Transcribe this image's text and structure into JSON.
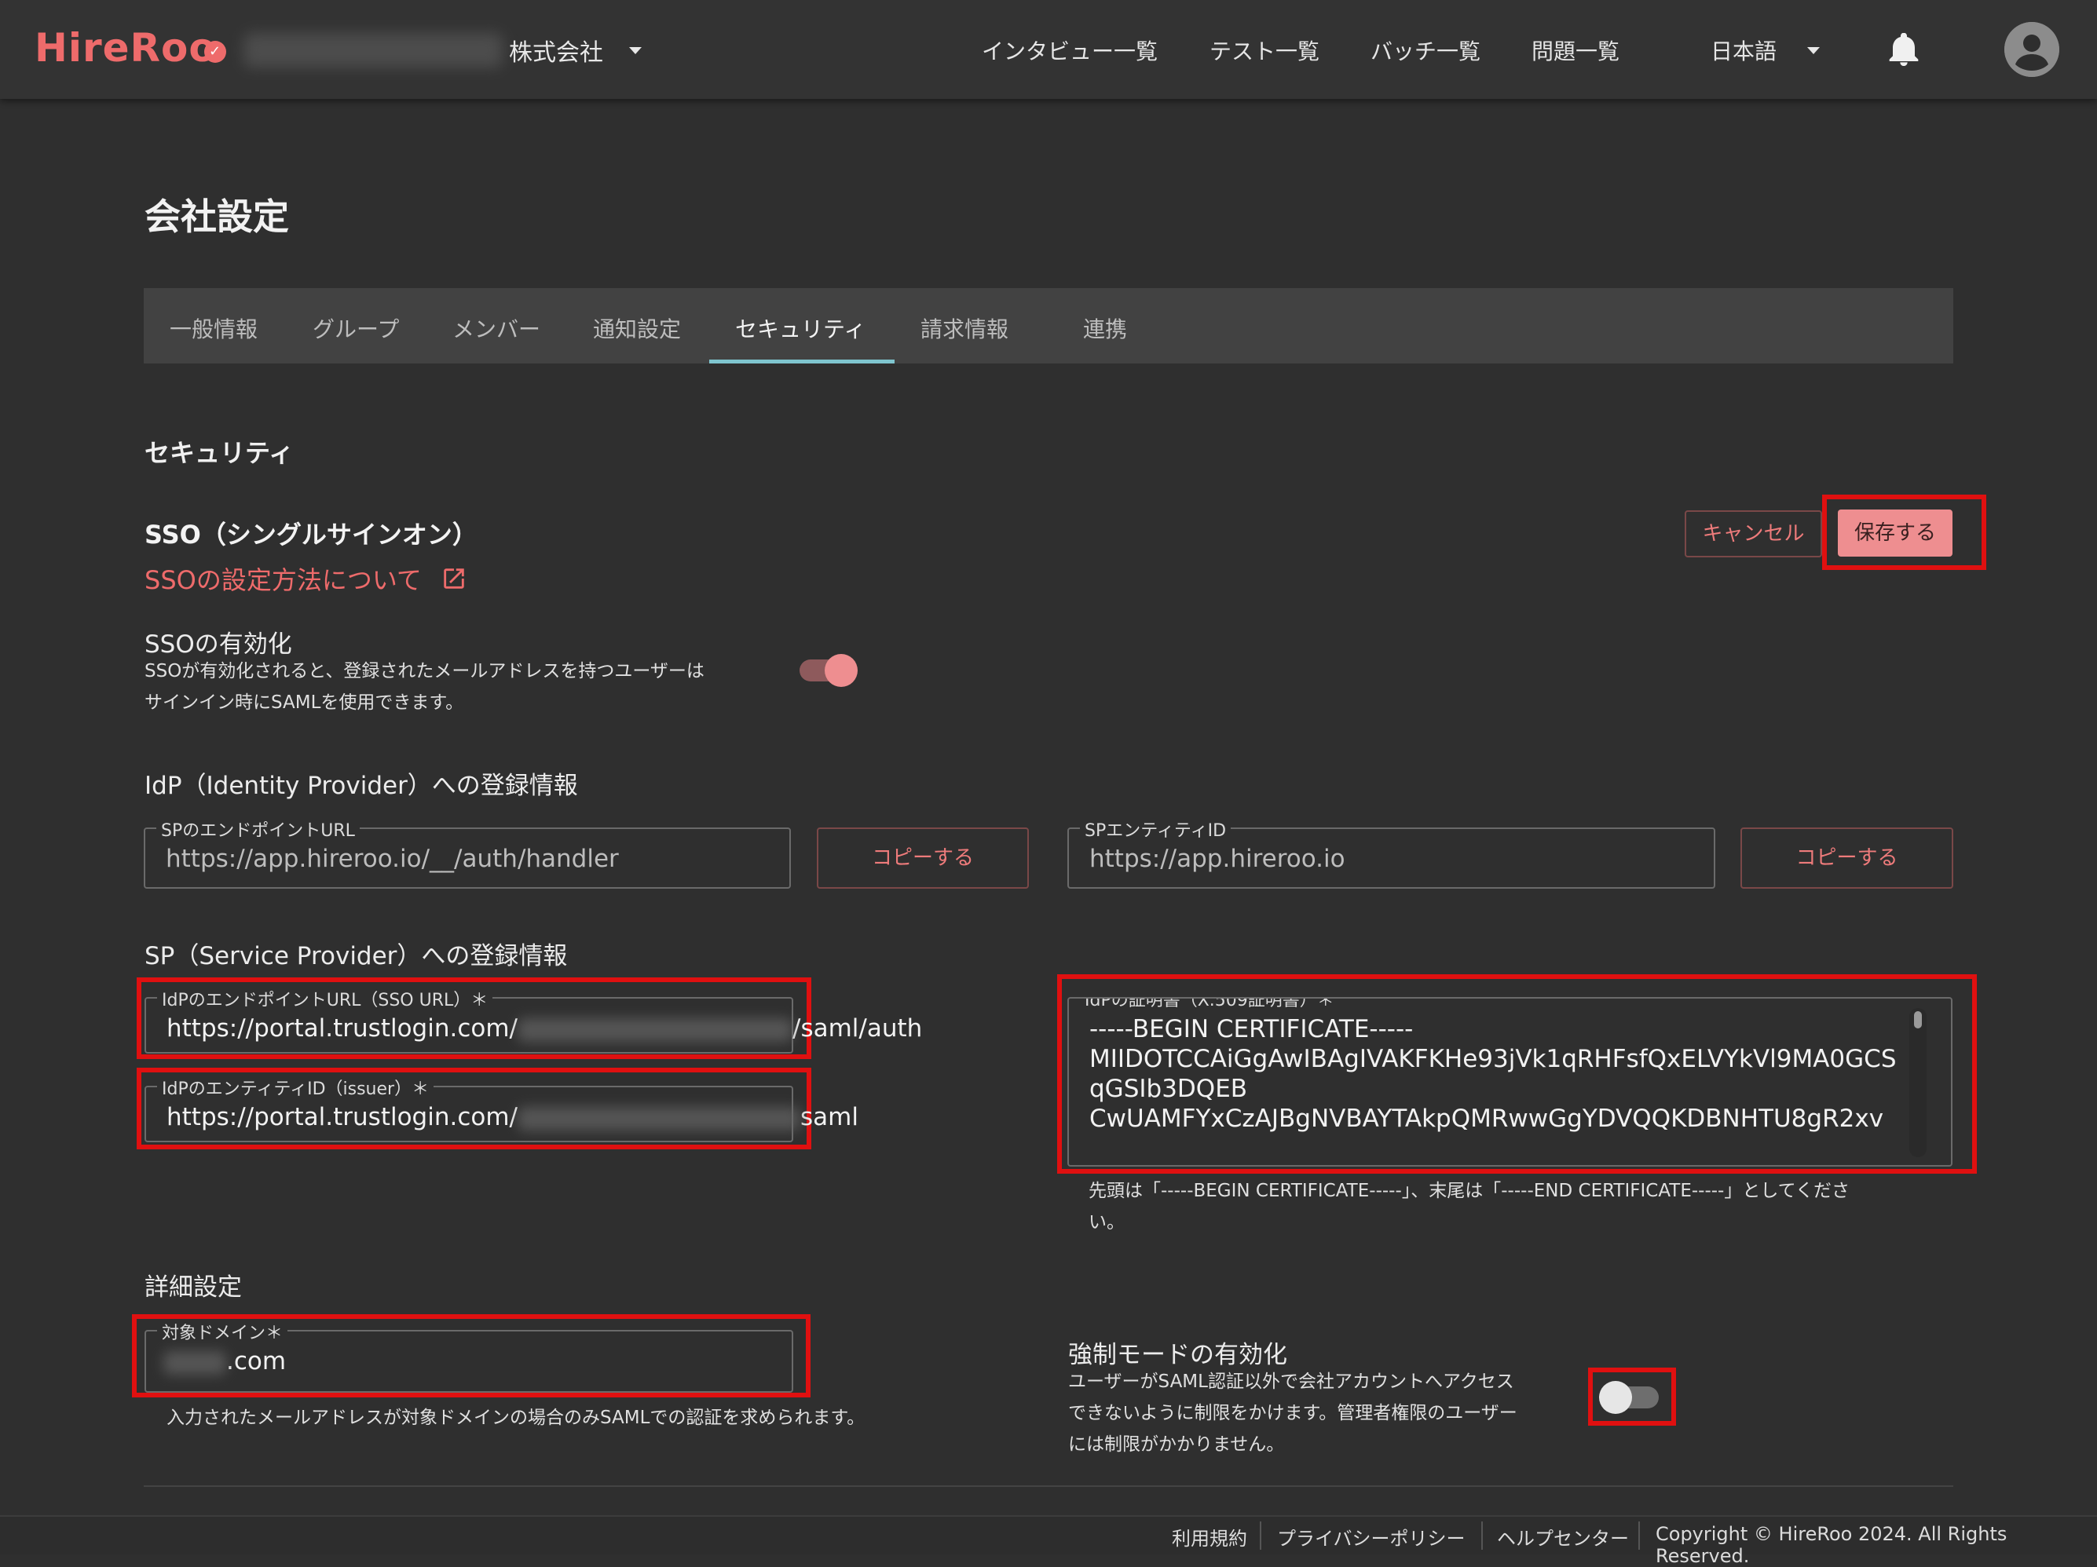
{
  "header": {
    "logo": "HireRoo",
    "company_suffix": "株式会社",
    "nav": [
      "インタビュー一覧",
      "テスト一覧",
      "バッチ一覧",
      "問題一覧"
    ],
    "language": "日本語",
    "icons": {
      "bell": "bell-icon",
      "avatar": "avatar-icon",
      "caret": "caret-down-icon"
    }
  },
  "page": {
    "title": "会社設定",
    "tabs": [
      "一般情報",
      "グループ",
      "メンバー",
      "通知設定",
      "セキュリティ",
      "請求情報",
      "連携"
    ],
    "active_tab": "セキュリティ",
    "section_title": "セキュリティ"
  },
  "sso": {
    "title": "SSO（シングルサインオン）",
    "link": "SSOの設定方法について",
    "cancel": "キャンセル",
    "save": "保存する",
    "enable_label": "SSOの有効化",
    "enable_desc_1": "SSOが有効化されると、登録されたメールアドレスを持つユーザーは",
    "enable_desc_2": "サインイン時にSAMLを使用できます。",
    "enabled": true
  },
  "idp_section": {
    "title": "IdP（Identity Provider）への登録情報",
    "sp_endpoint_label": "SPのエンドポイントURL",
    "sp_endpoint_value": "https://app.hireroo.io/__/auth/handler",
    "sp_entity_label": "SPエンティティID",
    "sp_entity_value": "https://app.hireroo.io",
    "copy": "コピーする"
  },
  "sp_section": {
    "title": "SP（Service Provider）への登録情報",
    "idp_endpoint_label": "IdPのエンドポイントURL（SSO URL）＊",
    "idp_endpoint_prefix": "https://portal.trustlogin.com/",
    "idp_endpoint_suffix": "/saml/auth",
    "idp_entity_label": "IdPのエンティティID（issuer）＊",
    "idp_entity_prefix": "https://portal.trustlogin.com/",
    "idp_entity_suffix": "saml",
    "cert_label": "IdPの証明書（X.509証明書）＊",
    "cert_lines": [
      "-----BEGIN CERTIFICATE-----",
      "MIIDOTCCAiGgAwIBAgIVAKFKHe93jVk1qRHFsfQxELVYkVl9MA0GCS",
      "qGSIb3DQEB",
      "CwUAMFYxCzAJBgNVBAYTAkpQMRwwGgYDVQQKDBNHTU8gR2xv"
    ],
    "cert_help_1": "先頭は「-----BEGIN CERTIFICATE-----」、末尾は「-----END CERTIFICATE-----」としてくださ",
    "cert_help_2": "い。"
  },
  "detail": {
    "title": "詳細設定",
    "domain_label": "対象ドメイン＊",
    "domain_suffix": ".com",
    "domain_help": "入力されたメールアドレスが対象ドメインの場合のみSAMLでの認証を求められます。",
    "force_label": "強制モードの有効化",
    "force_desc_1": "ユーザーがSAML認証以外で会社アカウントへアクセス",
    "force_desc_2": "できないように制限をかけます。管理者権限のユーザー",
    "force_desc_3": "には制限がかかりません。",
    "force_enabled": false
  },
  "footer": {
    "terms": "利用規約",
    "privacy": "プライバシーポリシー",
    "help": "ヘルプセンター",
    "copyright": "Copyright © HireRoo 2024. All Rights Reserved."
  },
  "colors": {
    "accent": "#ee6b6b",
    "tab_indicator": "#7fc5cf",
    "highlight": "#e01010"
  }
}
